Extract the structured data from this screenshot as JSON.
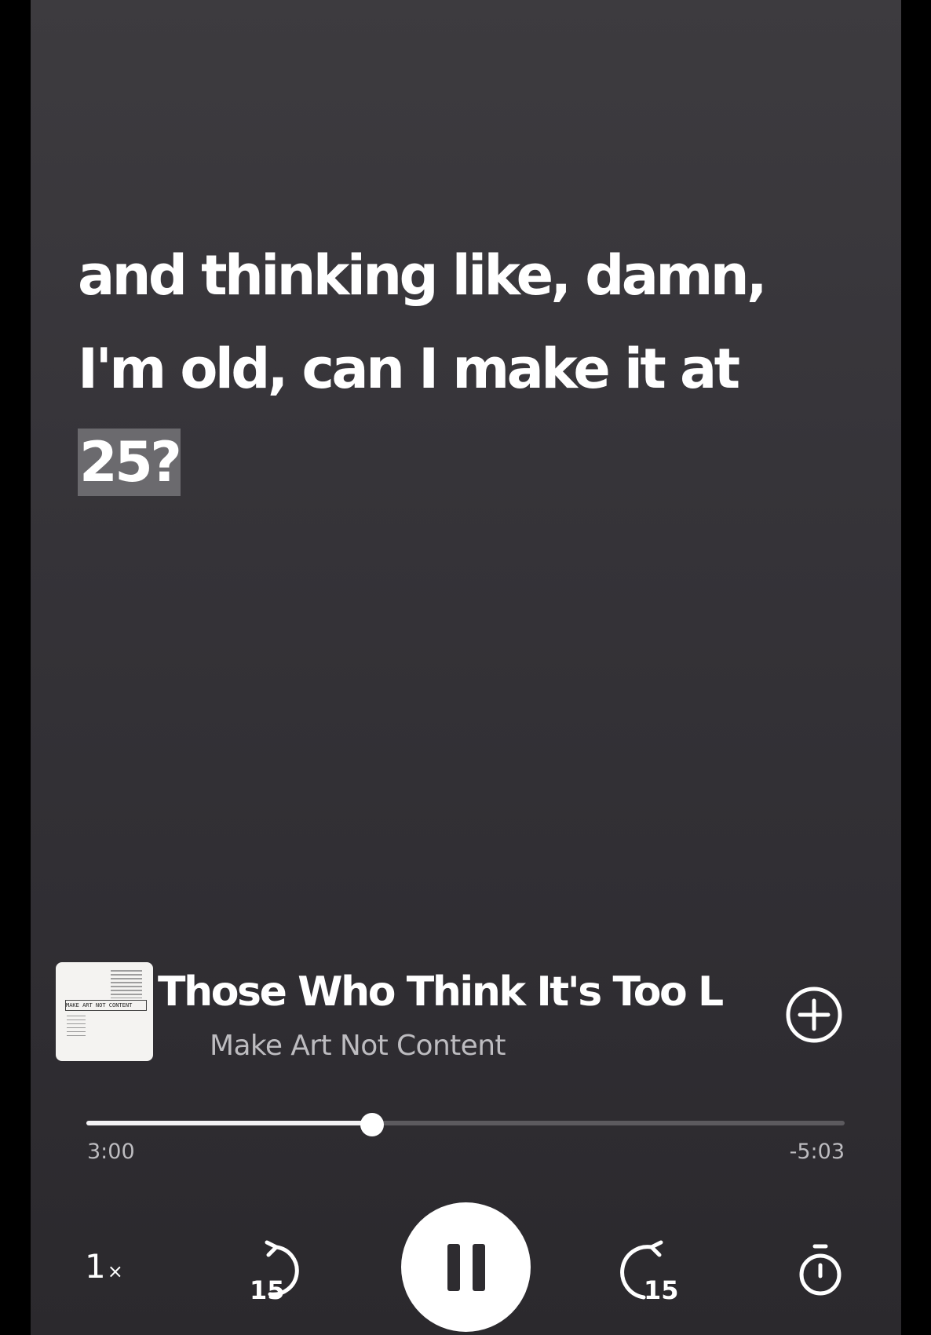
{
  "lyrics": {
    "lines": [
      "and thinking like, damn,",
      "I'm old, can I make it at"
    ],
    "current_word": "25?"
  },
  "now_playing": {
    "title": "Those Who Think It's Too L",
    "artist": "Make Art Not Content",
    "album_art_icon": "album-cover",
    "album_art_text": "MAKE ART NOT CONTENT"
  },
  "playback": {
    "elapsed": "3:00",
    "remaining": "-5:03",
    "progress_fraction": 0.377
  },
  "controls": {
    "speed_value": "1",
    "speed_suffix": "×",
    "skip_back_seconds": "15",
    "skip_forward_seconds": "15",
    "play_state_icon": "pause-icon",
    "timer_icon": "sleep-timer-icon",
    "add_icon": "add-circle-icon"
  },
  "colors": {
    "background_top": "#3d3b3f",
    "background_bottom": "#2b292d",
    "text_primary": "#ffffff",
    "text_secondary": "#bdbcc0",
    "highlight": "#6b6a6e"
  }
}
